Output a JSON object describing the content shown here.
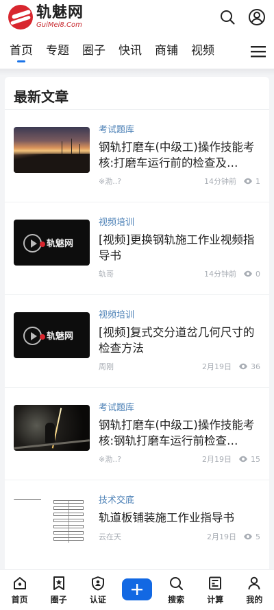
{
  "header": {
    "logo_cn": "轨魅网",
    "logo_en": "GuiMei8.Com",
    "icons": [
      "search-icon",
      "user-icon"
    ]
  },
  "nav": {
    "tabs": [
      {
        "label": "首页",
        "active": true
      },
      {
        "label": "专题",
        "active": false
      },
      {
        "label": "圈子",
        "active": false
      },
      {
        "label": "快讯",
        "active": false
      },
      {
        "label": "商铺",
        "active": false
      },
      {
        "label": "视频",
        "active": false
      }
    ],
    "menu_icon": "hamburger-menu-icon"
  },
  "section": {
    "title": "最新文章"
  },
  "articles": [
    {
      "category": "考试题库",
      "title": "钢轨打磨车(中级工)操作技能考核:打磨车运行前的检查及…",
      "author": "※泐..?",
      "time": "14分钟前",
      "views": "1",
      "thumb": "sunset-railway-image"
    },
    {
      "category": "视频培训",
      "title": "[视频]更换钢轨施工作业视频指导书",
      "author": "轨哥",
      "time": "14分钟前",
      "views": "0",
      "thumb": "video-thumbnail"
    },
    {
      "category": "视频培训",
      "title": "[视频]复式交分道岔几何尺寸的检查方法",
      "author": "周刚",
      "time": "2月19日",
      "views": "36",
      "thumb": "video-thumbnail"
    },
    {
      "category": "考试题库",
      "title": "钢轨打磨车(中级工)操作技能考核:钢轨打磨车运行前检查…",
      "author": "※泐..?",
      "time": "2月19日",
      "views": "15",
      "thumb": "night-grinding-image"
    },
    {
      "category": "技术交底",
      "title": "轨道板铺装施工作业指导书",
      "author": "云在天",
      "time": "2月19日",
      "views": "5",
      "thumb": "flowchart-document-image"
    }
  ],
  "bottom_bar": {
    "items": [
      {
        "label": "首页",
        "icon": "home-icon"
      },
      {
        "label": "圈子",
        "icon": "bookmark-star-icon"
      },
      {
        "label": "认证",
        "icon": "shield-user-icon"
      },
      {
        "label": "",
        "icon": "plus-icon"
      },
      {
        "label": "搜索",
        "icon": "search-icon"
      },
      {
        "label": "计算",
        "icon": "calculator-icon"
      },
      {
        "label": "我的",
        "icon": "user-icon"
      }
    ]
  },
  "colors": {
    "accent": "#1268e3",
    "brand_red": "#d8262e",
    "category_blue": "#4a7fb5",
    "meta_gray": "#a8adb4"
  }
}
